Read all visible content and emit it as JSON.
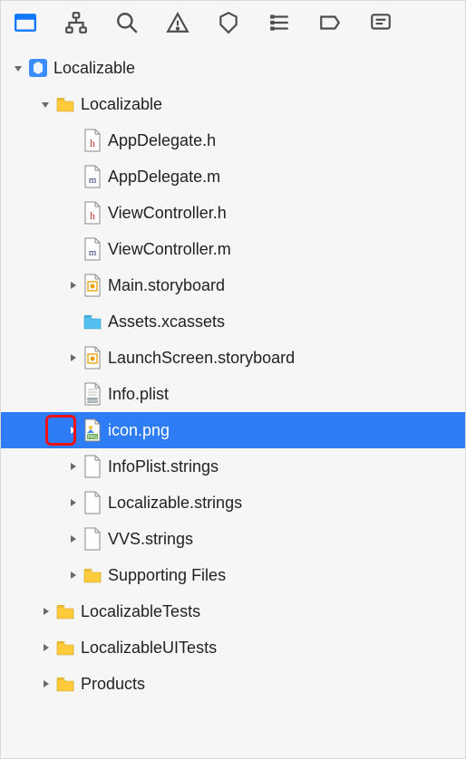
{
  "toolbar": {
    "items": [
      {
        "name": "file-navigator-icon",
        "active": true
      },
      {
        "name": "source-control-icon",
        "active": false
      },
      {
        "name": "search-icon",
        "active": false
      },
      {
        "name": "issues-icon",
        "active": false
      },
      {
        "name": "tests-icon",
        "active": false
      },
      {
        "name": "debug-icon",
        "active": false
      },
      {
        "name": "breakpoints-icon",
        "active": false
      },
      {
        "name": "reports-icon",
        "active": false
      }
    ]
  },
  "tree": [
    {
      "indent": 0,
      "disclosure": "open",
      "icon": "project",
      "label": "Localizable",
      "sel": false
    },
    {
      "indent": 1,
      "disclosure": "open",
      "icon": "folder",
      "label": "Localizable",
      "sel": false
    },
    {
      "indent": 2,
      "disclosure": "none",
      "icon": "h",
      "label": "AppDelegate.h",
      "sel": false
    },
    {
      "indent": 2,
      "disclosure": "none",
      "icon": "m",
      "label": "AppDelegate.m",
      "sel": false
    },
    {
      "indent": 2,
      "disclosure": "none",
      "icon": "h",
      "label": "ViewController.h",
      "sel": false
    },
    {
      "indent": 2,
      "disclosure": "none",
      "icon": "m",
      "label": "ViewController.m",
      "sel": false
    },
    {
      "indent": 2,
      "disclosure": "closed",
      "icon": "storyboard",
      "label": "Main.storyboard",
      "sel": false
    },
    {
      "indent": 2,
      "disclosure": "none",
      "icon": "assets",
      "label": "Assets.xcassets",
      "sel": false
    },
    {
      "indent": 2,
      "disclosure": "closed",
      "icon": "storyboard",
      "label": "LaunchScreen.storyboard",
      "sel": false
    },
    {
      "indent": 2,
      "disclosure": "none",
      "icon": "plist",
      "label": "Info.plist",
      "sel": false
    },
    {
      "indent": 2,
      "disclosure": "closed",
      "icon": "png",
      "label": "icon.png",
      "sel": true,
      "highlight": true
    },
    {
      "indent": 2,
      "disclosure": "closed",
      "icon": "strings",
      "label": "InfoPlist.strings",
      "sel": false
    },
    {
      "indent": 2,
      "disclosure": "closed",
      "icon": "strings",
      "label": "Localizable.strings",
      "sel": false
    },
    {
      "indent": 2,
      "disclosure": "closed",
      "icon": "strings",
      "label": "VVS.strings",
      "sel": false
    },
    {
      "indent": 2,
      "disclosure": "closed",
      "icon": "folder",
      "label": "Supporting Files",
      "sel": false
    },
    {
      "indent": 1,
      "disclosure": "closed",
      "icon": "folder",
      "label": "LocalizableTests",
      "sel": false
    },
    {
      "indent": 1,
      "disclosure": "closed",
      "icon": "folder",
      "label": "LocalizableUITests",
      "sel": false
    },
    {
      "indent": 1,
      "disclosure": "closed",
      "icon": "folder",
      "label": "Products",
      "sel": false
    }
  ],
  "colors": {
    "selection": "#2e7cf6",
    "highlight_ring": "#e11",
    "folder": "#ffcb3b",
    "assets_folder": "#54c0ee",
    "project": "#3b8dff"
  }
}
